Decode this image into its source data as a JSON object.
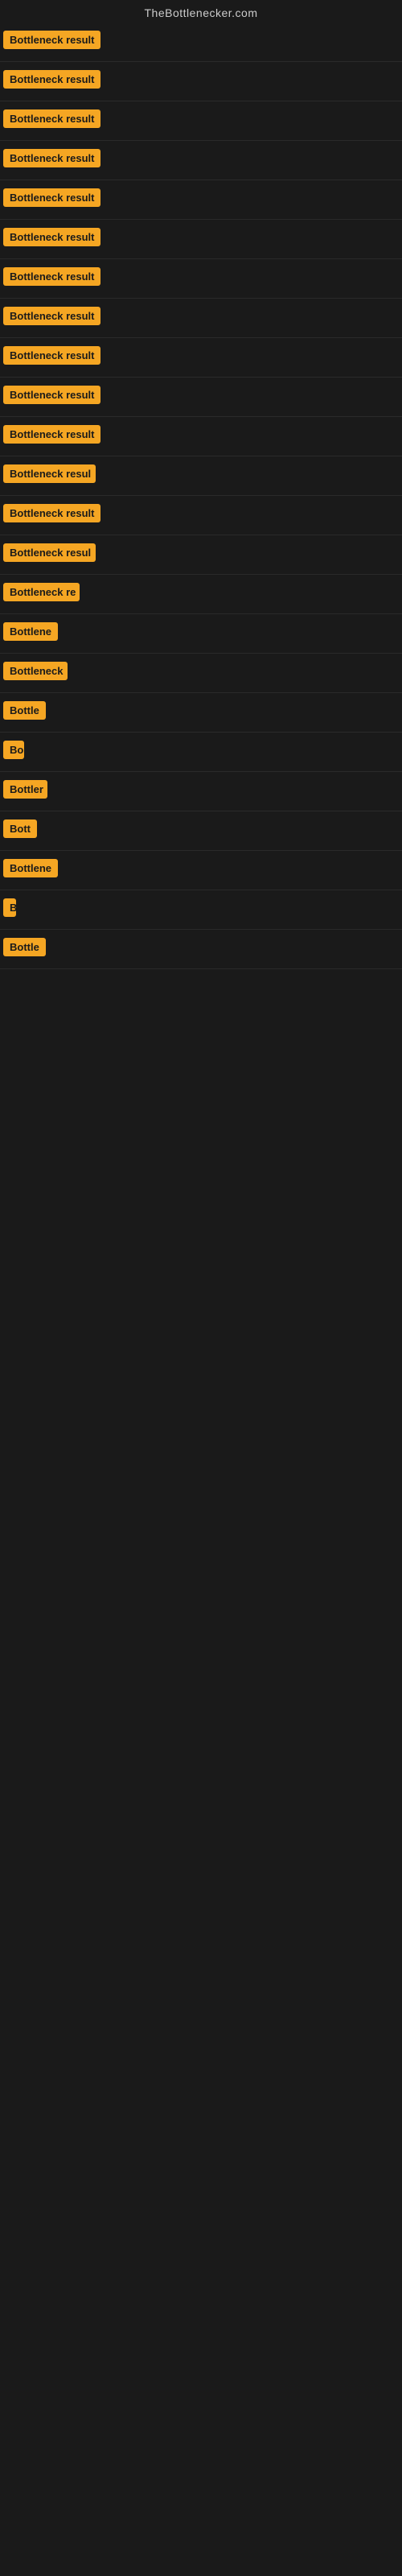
{
  "site": {
    "title": "TheBottlenecker.com"
  },
  "rows": [
    {
      "id": 1,
      "label": "Bottleneck result",
      "width": 130
    },
    {
      "id": 2,
      "label": "Bottleneck result",
      "width": 130
    },
    {
      "id": 3,
      "label": "Bottleneck result",
      "width": 130
    },
    {
      "id": 4,
      "label": "Bottleneck result",
      "width": 130
    },
    {
      "id": 5,
      "label": "Bottleneck result",
      "width": 130
    },
    {
      "id": 6,
      "label": "Bottleneck result",
      "width": 130
    },
    {
      "id": 7,
      "label": "Bottleneck result",
      "width": 130
    },
    {
      "id": 8,
      "label": "Bottleneck result",
      "width": 130
    },
    {
      "id": 9,
      "label": "Bottleneck result",
      "width": 130
    },
    {
      "id": 10,
      "label": "Bottleneck result",
      "width": 130
    },
    {
      "id": 11,
      "label": "Bottleneck result",
      "width": 130
    },
    {
      "id": 12,
      "label": "Bottleneck resul",
      "width": 115
    },
    {
      "id": 13,
      "label": "Bottleneck result",
      "width": 130
    },
    {
      "id": 14,
      "label": "Bottleneck resul",
      "width": 115
    },
    {
      "id": 15,
      "label": "Bottleneck re",
      "width": 95
    },
    {
      "id": 16,
      "label": "Bottlene",
      "width": 72
    },
    {
      "id": 17,
      "label": "Bottleneck",
      "width": 80
    },
    {
      "id": 18,
      "label": "Bottle",
      "width": 58
    },
    {
      "id": 19,
      "label": "Bo",
      "width": 26
    },
    {
      "id": 20,
      "label": "Bottler",
      "width": 55
    },
    {
      "id": 21,
      "label": "Bott",
      "width": 42
    },
    {
      "id": 22,
      "label": "Bottlene",
      "width": 72
    },
    {
      "id": 23,
      "label": "B",
      "width": 16
    },
    {
      "id": 24,
      "label": "Bottle",
      "width": 58
    }
  ]
}
